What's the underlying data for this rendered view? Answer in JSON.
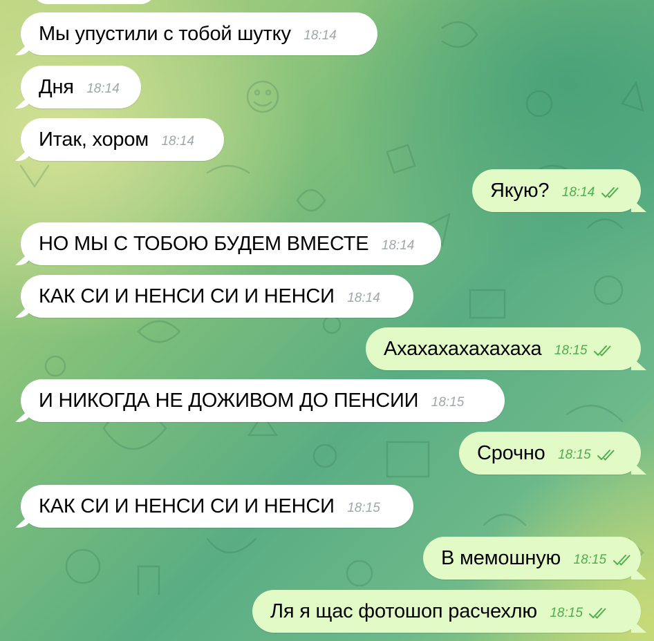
{
  "chat": {
    "messages": [
      {
        "dir": "in",
        "text": "Мы упустили с тобой шутку",
        "time": "18:14"
      },
      {
        "dir": "in",
        "text": "Дня",
        "time": "18:14"
      },
      {
        "dir": "in",
        "text": "Итак, хором",
        "time": "18:14"
      },
      {
        "dir": "out",
        "text": "Якую?",
        "time": "18:14"
      },
      {
        "dir": "in",
        "text": "НО МЫ С ТОБОЮ БУДЕМ ВМЕСТЕ",
        "time": "18:14"
      },
      {
        "dir": "in",
        "text": "КАК СИ И НЕНСИ СИ И НЕНСИ",
        "time": "18:14"
      },
      {
        "dir": "out",
        "text": "Ахахахахахахаха",
        "time": "18:15"
      },
      {
        "dir": "in",
        "text": "И НИКОГДА НЕ ДОЖИВОМ ДО ПЕНСИИ",
        "time": "18:15"
      },
      {
        "dir": "out",
        "text": "Срочно",
        "time": "18:15"
      },
      {
        "dir": "in",
        "text": "КАК СИ И НЕНСИ СИ И НЕНСИ",
        "time": "18:15"
      },
      {
        "dir": "out",
        "text": "В мемошную",
        "time": "18:15"
      },
      {
        "dir": "out",
        "text": "Ля я щас фотошоп расчехлю",
        "time": "18:15"
      }
    ]
  },
  "colors": {
    "incoming_bubble": "#ffffff",
    "outgoing_bubble": "#e2fbc6",
    "read_check": "#4fae4e",
    "timestamp_gray": "#a0a6ad"
  },
  "icons": {
    "read_receipt": "double-check-icon",
    "background": "doodle-pattern"
  }
}
